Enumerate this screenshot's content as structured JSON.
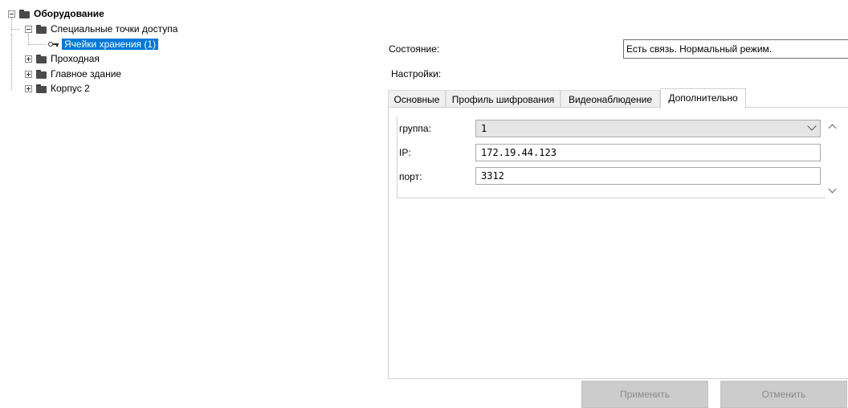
{
  "tree": {
    "root": "Оборудование",
    "special_points": "Специальные точки доступа",
    "storage_cells": "Ячейки хранения (1)",
    "passage": "Проходная",
    "main_building": "Главное здание",
    "building2": "Корпус 2"
  },
  "status": {
    "label": "Состояние:",
    "value": "Есть связь. Нормальный режим."
  },
  "settings": {
    "label": "Настройки:"
  },
  "tabs": [
    "Основные",
    "Профиль шифрования",
    "Видеонаблюдение",
    "Дополнительно"
  ],
  "active_tab": "Дополнительно",
  "properties": {
    "group_label": "группа:",
    "group_value": "1",
    "ip_label": "IP:",
    "ip_value": "172.19.44.123",
    "port_label": "порт:",
    "port_value": "3312"
  },
  "buttons": {
    "apply": "Применить",
    "cancel": "Отменить"
  },
  "colors": {
    "selection": "#0078d7",
    "disabled_button": "#cccccc"
  }
}
